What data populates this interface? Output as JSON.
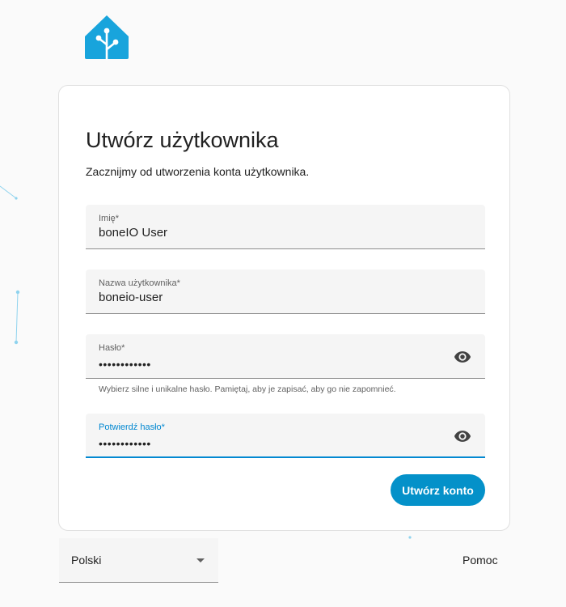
{
  "colors": {
    "accent": "#0491c9",
    "logo": "#18a4dc",
    "focus": "#0288d1"
  },
  "logo": {
    "icon": "home-assistant-logo"
  },
  "card": {
    "title": "Utwórz użytkownika",
    "subtitle": "Zacznijmy od utworzenia konta użytkownika."
  },
  "fields": {
    "name": {
      "label": "Imię*",
      "value": "boneIO User"
    },
    "username": {
      "label": "Nazwa użytkownika*",
      "value": "boneio-user"
    },
    "password": {
      "label": "Hasło*",
      "value": "••••••••••••",
      "helper": "Wybierz silne i unikalne hasło. Pamiętaj, aby je zapisać, aby go nie zapomnieć.",
      "icon": "eye-icon"
    },
    "confirm": {
      "label": "Potwierdź hasło*",
      "value": "••••••••••••",
      "icon": "eye-icon"
    }
  },
  "actions": {
    "create_label": "Utwórz konto"
  },
  "footer": {
    "language": "Polski",
    "help": "Pomoc"
  }
}
